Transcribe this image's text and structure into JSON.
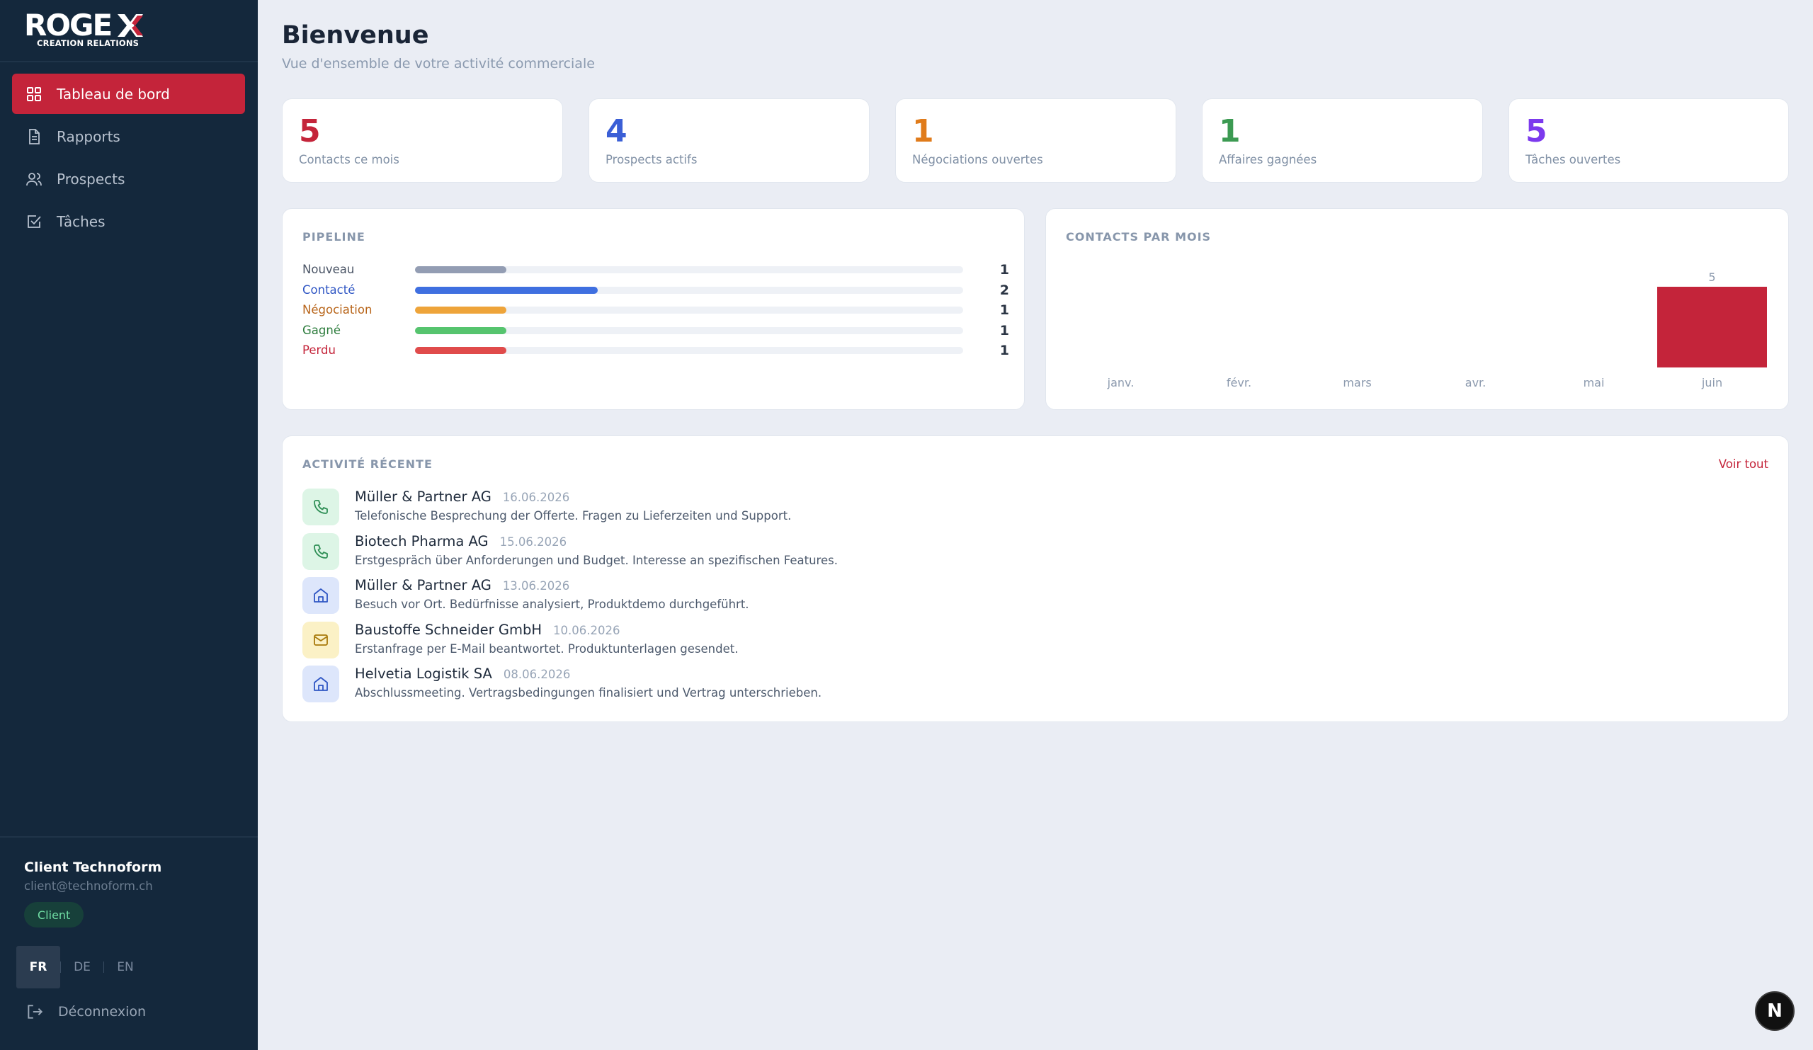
{
  "brand": {
    "name": "ROGE",
    "tagline": "CREATION RELATIONS",
    "accent": "#c4243a"
  },
  "nav": [
    {
      "label": "Tableau de bord",
      "icon": "dashboard-grid-icon",
      "active": true
    },
    {
      "label": "Rapports",
      "icon": "document-icon",
      "active": false
    },
    {
      "label": "Prospects",
      "icon": "users-icon",
      "active": false
    },
    {
      "label": "Tâches",
      "icon": "checkbox-icon",
      "active": false
    }
  ],
  "user": {
    "name": "Client Technoform",
    "email": "client@technoform.ch",
    "role": "Client"
  },
  "languages": [
    "FR",
    "DE",
    "EN"
  ],
  "active_language": "FR",
  "logout_label": "Déconnexion",
  "header": {
    "title": "Bienvenue",
    "subtitle": "Vue d'ensemble de votre activité commerciale"
  },
  "stats": [
    {
      "value": "5",
      "label": "Contacts ce mois",
      "color": "#c4243a"
    },
    {
      "value": "4",
      "label": "Prospects actifs",
      "color": "#3b5fd6"
    },
    {
      "value": "1",
      "label": "Négociations ouvertes",
      "color": "#e07b1a"
    },
    {
      "value": "1",
      "label": "Affaires gagnées",
      "color": "#3c9a52"
    },
    {
      "value": "5",
      "label": "Tâches ouvertes",
      "color": "#7c3aed"
    }
  ],
  "pipeline": {
    "title": "PIPELINE",
    "max": 6,
    "stages": [
      {
        "label": "Nouveau",
        "count": 1,
        "color": "#939db3",
        "text_color": "#4b5566"
      },
      {
        "label": "Contacté",
        "count": 2,
        "color": "#3f6fe0",
        "text_color": "#2f56c4"
      },
      {
        "label": "Négociation",
        "count": 1,
        "color": "#eea43a",
        "text_color": "#b8651a"
      },
      {
        "label": "Gagné",
        "count": 1,
        "color": "#56c46e",
        "text_color": "#2e7d3e"
      },
      {
        "label": "Perdu",
        "count": 1,
        "color": "#e04b4b",
        "text_color": "#c4243a"
      }
    ]
  },
  "contacts_chart": {
    "title": "CONTACTS PAR MOIS"
  },
  "chart_data": {
    "type": "bar",
    "categories": [
      "janv.",
      "févr.",
      "mars",
      "avr.",
      "mai",
      "juin"
    ],
    "values": [
      0,
      0,
      0,
      0,
      0,
      5
    ],
    "title": "CONTACTS PAR MOIS",
    "xlabel": "",
    "ylabel": "",
    "ylim": [
      0,
      5
    ],
    "grid": false,
    "color": "#c4243a"
  },
  "activity": {
    "title": "ACTIVITÉ RÉCENTE",
    "see_all": "Voir tout",
    "items": [
      {
        "type": "call",
        "icon": "phone-icon",
        "company": "Müller & Partner AG",
        "date": "16.06.2026",
        "desc": "Telefonische Besprechung der Offerte. Fragen zu Lieferzeiten und Support."
      },
      {
        "type": "call",
        "icon": "phone-icon",
        "company": "Biotech Pharma AG",
        "date": "15.06.2026",
        "desc": "Erstgespräch über Anforderungen und Budget. Interesse an spezifischen Features."
      },
      {
        "type": "visit",
        "icon": "home-icon",
        "company": "Müller & Partner AG",
        "date": "13.06.2026",
        "desc": "Besuch vor Ort. Bedürfnisse analysiert, Produktdemo durchgeführt."
      },
      {
        "type": "mail",
        "icon": "mail-icon",
        "company": "Baustoffe Schneider GmbH",
        "date": "10.06.2026",
        "desc": "Erstanfrage per E-Mail beantwortet. Produktunterlagen gesendet."
      },
      {
        "type": "visit",
        "icon": "home-icon",
        "company": "Helvetia Logistik SA",
        "date": "08.06.2026",
        "desc": "Abschlussmeeting. Vertragsbedingungen finalisiert und Vertrag unterschrieben."
      }
    ]
  },
  "fab": {
    "label": "N",
    "icon": "nextjs-icon"
  }
}
